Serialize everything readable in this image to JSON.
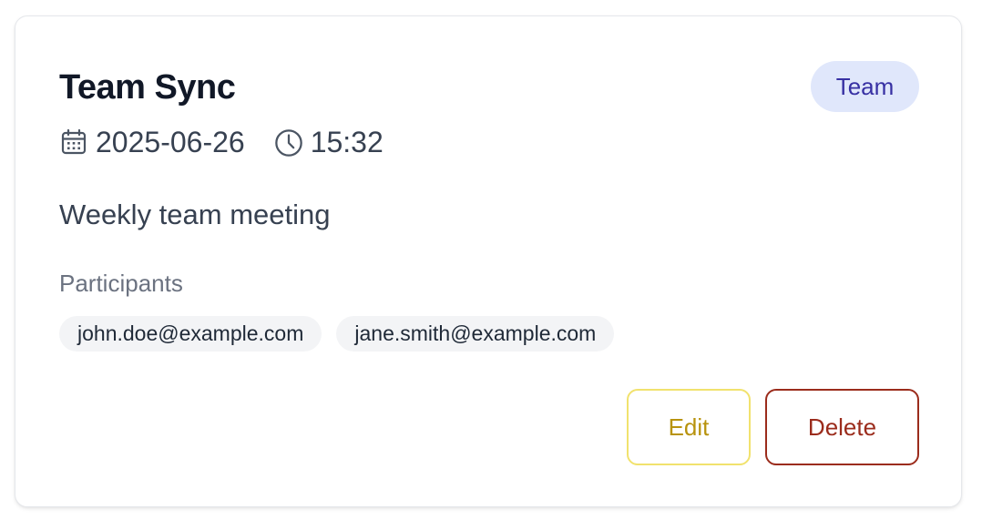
{
  "event": {
    "title": "Team Sync",
    "category": "Team",
    "date": "2025-06-26",
    "time": "15:32",
    "description": "Weekly team meeting",
    "participants_label": "Participants",
    "participants": [
      "john.doe@example.com",
      "jane.smith@example.com"
    ]
  },
  "actions": {
    "edit_label": "Edit",
    "delete_label": "Delete"
  },
  "icons": {
    "date": "calendar-icon",
    "time": "clock-icon"
  },
  "colors": {
    "badge_bg": "#e0e7fb",
    "badge_text": "#3730a3",
    "edit_border": "#f1e26d",
    "edit_text": "#b8930e",
    "delete": "#9b2c1c"
  }
}
